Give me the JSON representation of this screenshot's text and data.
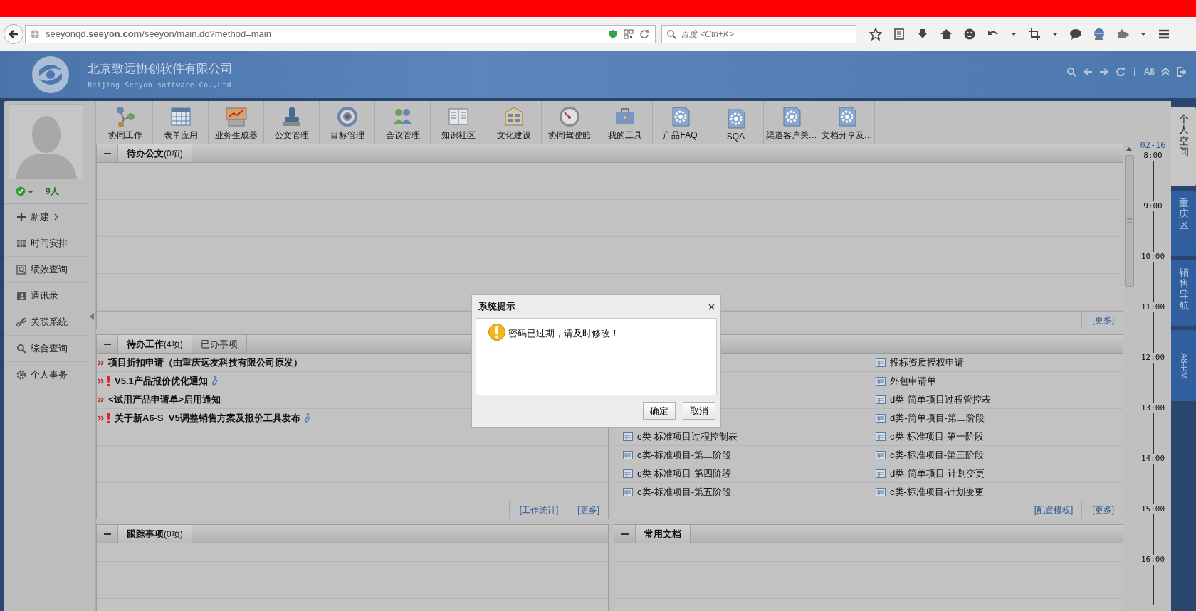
{
  "browser": {
    "url": "seeyonqd.**seeyon.com**/seeyon/main.do?method=main",
    "search": {
      "placeholder": "百度 <Ctrl+K>"
    }
  },
  "header": {
    "company": "北京致远协创软件有限公司",
    "company_en": "Beijing Seeyon software Co.,Ltd",
    "version": "A8"
  },
  "user": {
    "online": "9人"
  },
  "sidebar": {
    "items": [
      {
        "label": "新建",
        "submenu": true
      },
      {
        "label": "时间安排",
        "submenu": false
      },
      {
        "label": "绩效查询",
        "submenu": false
      },
      {
        "label": "通讯录",
        "submenu": false
      },
      {
        "label": "关联系统",
        "submenu": false
      },
      {
        "label": "综合查询",
        "submenu": false
      },
      {
        "label": "个人事务",
        "submenu": false
      }
    ]
  },
  "apps": [
    {
      "label": "协同工作"
    },
    {
      "label": "表单应用"
    },
    {
      "label": "业务生成器"
    },
    {
      "label": "公文管理"
    },
    {
      "label": "目标管理"
    },
    {
      "label": "会议管理"
    },
    {
      "label": "知识社区"
    },
    {
      "label": "文化建设"
    },
    {
      "label": "协同驾驶舱"
    },
    {
      "label": "我的工具"
    },
    {
      "label": "产品FAQ"
    },
    {
      "label": "SQA"
    },
    {
      "label": "渠道客户关…"
    },
    {
      "label": "文档分享及…"
    }
  ],
  "pending_docs": {
    "tabs": [
      {
        "title": "待办公文",
        "count": "(0项)",
        "selected": true
      }
    ],
    "links": [
      "[更多]"
    ]
  },
  "pending_work": {
    "tabs": [
      {
        "title": "待办工作",
        "count": "(4项)",
        "selected": true
      },
      {
        "title": "已办事项",
        "selected": false
      }
    ],
    "items": [
      {
        "text": "项目折扣申请（由重庆远友科技有限公司原发）",
        "important": false,
        "attachment": false
      },
      {
        "text": "V5.1产品报价优化通知",
        "important": true,
        "attachment": true
      },
      {
        "text": "<试用产品申请单>启用通知",
        "important": false,
        "attachment": false
      },
      {
        "text": "关于新A6-S  V5调整销售方案及报价工具发布",
        "important": true,
        "attachment": true
      }
    ],
    "links": [
      "[工作统计]",
      "[更多]"
    ]
  },
  "templates": {
    "left": [
      "c类-标准项目过程控制表",
      "c类-标准项目-第二阶段",
      "c类-标准项目-第四阶段",
      "c类-标准项目-第五阶段"
    ],
    "right": [
      "投标资质授权申请",
      "外包申请单",
      "d类-简单项目过程管控表",
      "d类-简单项目-第二阶段",
      "c类-标准项目-第一阶段",
      "c类-标准项目-第三阶段",
      "d类-简单项目-计划变更",
      "c类-标准项目-计划变更"
    ],
    "links": [
      "[配置模板]",
      "[更多]"
    ]
  },
  "tracking": {
    "tabs": [
      {
        "title": "跟踪事项",
        "count": "(0项)",
        "selected": true
      }
    ]
  },
  "common_docs": {
    "tabs": [
      {
        "title": "常用文档",
        "selected": true
      }
    ]
  },
  "timeline": {
    "date": "02-16",
    "hours": [
      "8:00",
      "9:00",
      "10:00",
      "11:00",
      "12:00",
      "13:00",
      "14:00",
      "15:00",
      "16:00"
    ]
  },
  "side_tabs": [
    {
      "label": "个人空间",
      "selected": true,
      "kind": "stacked"
    },
    {
      "label": "重庆区",
      "selected": false,
      "kind": "stacked"
    },
    {
      "label": "销售导航",
      "selected": false,
      "kind": "stacked"
    },
    {
      "label": "A8-PM",
      "selected": false,
      "kind": "rotated"
    }
  ],
  "dialog": {
    "title": "系统提示",
    "message": "密码已过期，请及时修改！",
    "buttons": [
      "确定",
      "取消"
    ]
  }
}
